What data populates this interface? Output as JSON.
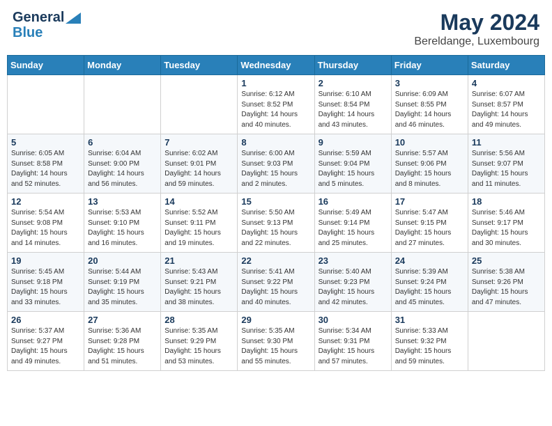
{
  "header": {
    "logo_general": "General",
    "logo_blue": "Blue",
    "title": "May 2024",
    "subtitle": "Bereldange, Luxembourg"
  },
  "weekdays": [
    "Sunday",
    "Monday",
    "Tuesday",
    "Wednesday",
    "Thursday",
    "Friday",
    "Saturday"
  ],
  "weeks": [
    [
      {
        "day": "",
        "info": ""
      },
      {
        "day": "",
        "info": ""
      },
      {
        "day": "",
        "info": ""
      },
      {
        "day": "1",
        "info": "Sunrise: 6:12 AM\nSunset: 8:52 PM\nDaylight: 14 hours\nand 40 minutes."
      },
      {
        "day": "2",
        "info": "Sunrise: 6:10 AM\nSunset: 8:54 PM\nDaylight: 14 hours\nand 43 minutes."
      },
      {
        "day": "3",
        "info": "Sunrise: 6:09 AM\nSunset: 8:55 PM\nDaylight: 14 hours\nand 46 minutes."
      },
      {
        "day": "4",
        "info": "Sunrise: 6:07 AM\nSunset: 8:57 PM\nDaylight: 14 hours\nand 49 minutes."
      }
    ],
    [
      {
        "day": "5",
        "info": "Sunrise: 6:05 AM\nSunset: 8:58 PM\nDaylight: 14 hours\nand 52 minutes."
      },
      {
        "day": "6",
        "info": "Sunrise: 6:04 AM\nSunset: 9:00 PM\nDaylight: 14 hours\nand 56 minutes."
      },
      {
        "day": "7",
        "info": "Sunrise: 6:02 AM\nSunset: 9:01 PM\nDaylight: 14 hours\nand 59 minutes."
      },
      {
        "day": "8",
        "info": "Sunrise: 6:00 AM\nSunset: 9:03 PM\nDaylight: 15 hours\nand 2 minutes."
      },
      {
        "day": "9",
        "info": "Sunrise: 5:59 AM\nSunset: 9:04 PM\nDaylight: 15 hours\nand 5 minutes."
      },
      {
        "day": "10",
        "info": "Sunrise: 5:57 AM\nSunset: 9:06 PM\nDaylight: 15 hours\nand 8 minutes."
      },
      {
        "day": "11",
        "info": "Sunrise: 5:56 AM\nSunset: 9:07 PM\nDaylight: 15 hours\nand 11 minutes."
      }
    ],
    [
      {
        "day": "12",
        "info": "Sunrise: 5:54 AM\nSunset: 9:08 PM\nDaylight: 15 hours\nand 14 minutes."
      },
      {
        "day": "13",
        "info": "Sunrise: 5:53 AM\nSunset: 9:10 PM\nDaylight: 15 hours\nand 16 minutes."
      },
      {
        "day": "14",
        "info": "Sunrise: 5:52 AM\nSunset: 9:11 PM\nDaylight: 15 hours\nand 19 minutes."
      },
      {
        "day": "15",
        "info": "Sunrise: 5:50 AM\nSunset: 9:13 PM\nDaylight: 15 hours\nand 22 minutes."
      },
      {
        "day": "16",
        "info": "Sunrise: 5:49 AM\nSunset: 9:14 PM\nDaylight: 15 hours\nand 25 minutes."
      },
      {
        "day": "17",
        "info": "Sunrise: 5:47 AM\nSunset: 9:15 PM\nDaylight: 15 hours\nand 27 minutes."
      },
      {
        "day": "18",
        "info": "Sunrise: 5:46 AM\nSunset: 9:17 PM\nDaylight: 15 hours\nand 30 minutes."
      }
    ],
    [
      {
        "day": "19",
        "info": "Sunrise: 5:45 AM\nSunset: 9:18 PM\nDaylight: 15 hours\nand 33 minutes."
      },
      {
        "day": "20",
        "info": "Sunrise: 5:44 AM\nSunset: 9:19 PM\nDaylight: 15 hours\nand 35 minutes."
      },
      {
        "day": "21",
        "info": "Sunrise: 5:43 AM\nSunset: 9:21 PM\nDaylight: 15 hours\nand 38 minutes."
      },
      {
        "day": "22",
        "info": "Sunrise: 5:41 AM\nSunset: 9:22 PM\nDaylight: 15 hours\nand 40 minutes."
      },
      {
        "day": "23",
        "info": "Sunrise: 5:40 AM\nSunset: 9:23 PM\nDaylight: 15 hours\nand 42 minutes."
      },
      {
        "day": "24",
        "info": "Sunrise: 5:39 AM\nSunset: 9:24 PM\nDaylight: 15 hours\nand 45 minutes."
      },
      {
        "day": "25",
        "info": "Sunrise: 5:38 AM\nSunset: 9:26 PM\nDaylight: 15 hours\nand 47 minutes."
      }
    ],
    [
      {
        "day": "26",
        "info": "Sunrise: 5:37 AM\nSunset: 9:27 PM\nDaylight: 15 hours\nand 49 minutes."
      },
      {
        "day": "27",
        "info": "Sunrise: 5:36 AM\nSunset: 9:28 PM\nDaylight: 15 hours\nand 51 minutes."
      },
      {
        "day": "28",
        "info": "Sunrise: 5:35 AM\nSunset: 9:29 PM\nDaylight: 15 hours\nand 53 minutes."
      },
      {
        "day": "29",
        "info": "Sunrise: 5:35 AM\nSunset: 9:30 PM\nDaylight: 15 hours\nand 55 minutes."
      },
      {
        "day": "30",
        "info": "Sunrise: 5:34 AM\nSunset: 9:31 PM\nDaylight: 15 hours\nand 57 minutes."
      },
      {
        "day": "31",
        "info": "Sunrise: 5:33 AM\nSunset: 9:32 PM\nDaylight: 15 hours\nand 59 minutes."
      },
      {
        "day": "",
        "info": ""
      }
    ]
  ]
}
